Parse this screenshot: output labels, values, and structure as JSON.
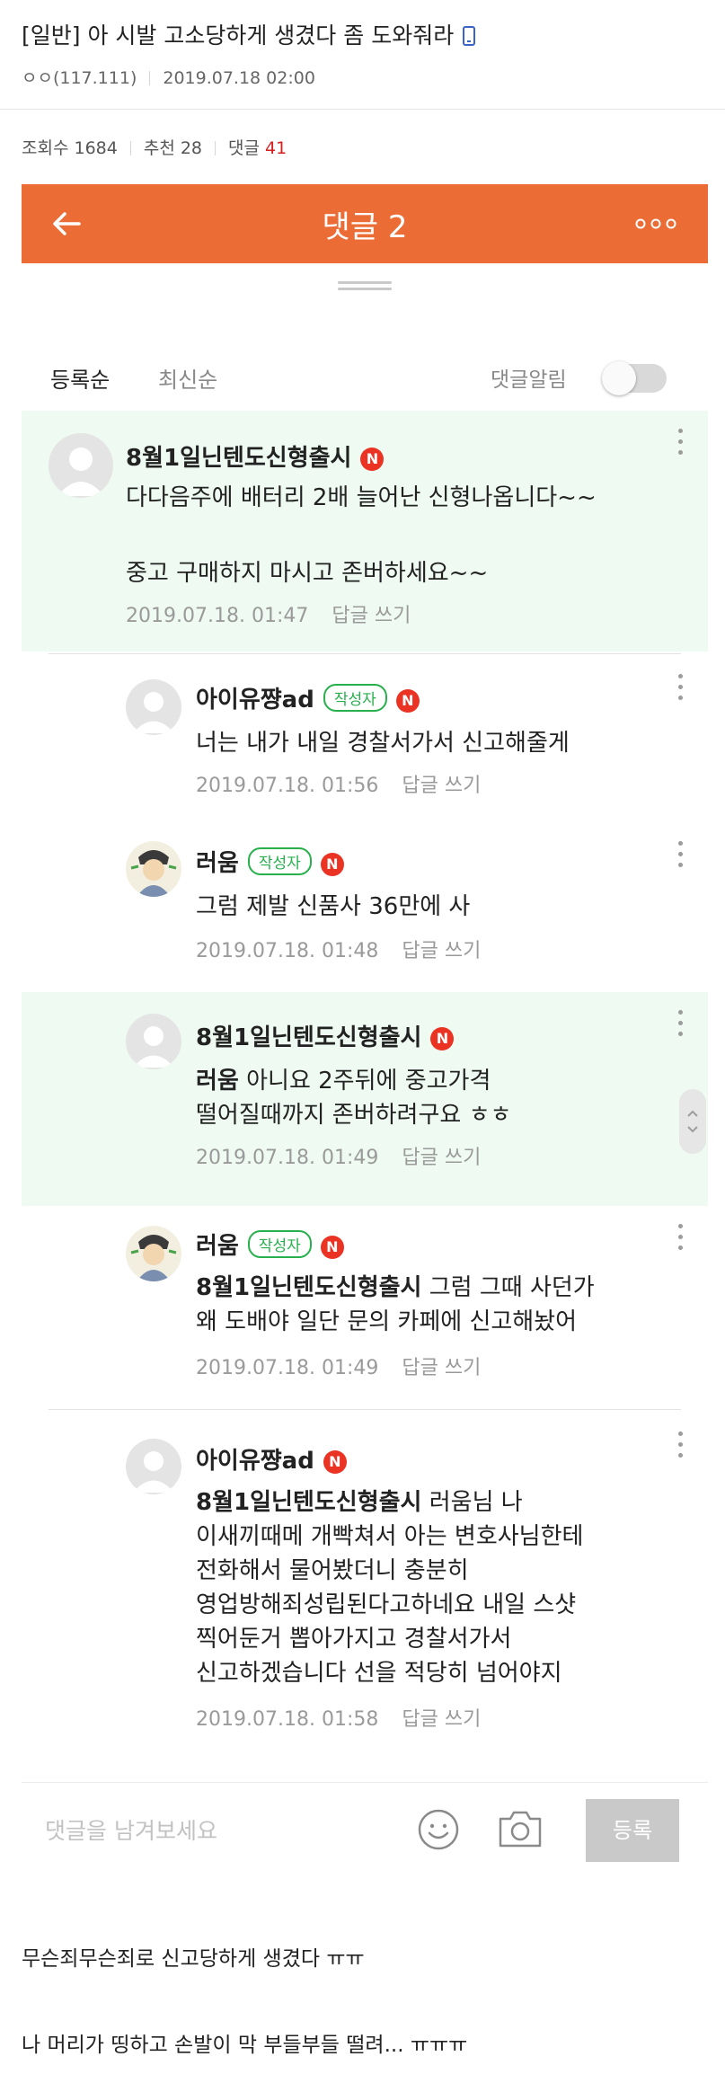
{
  "post": {
    "title": "[일반] 아 시발 고소당하게 생겼다 좀 도와줘라",
    "author": "ㅇㅇ(117.111)",
    "datetime": "2019.07.18 02:00",
    "views_label": "조회수 1684",
    "recommend_label": "추천 28",
    "comments_label": "댓글",
    "comments_count": "41"
  },
  "app": {
    "title": "댓글 2",
    "sort_registered": "등록순",
    "sort_latest": "최신순",
    "alarm_label": "댓글알림",
    "alarm_on": false,
    "input_placeholder": "댓글을 남겨보세요",
    "submit_label": "등록",
    "reply_label": "답글 쓰기",
    "author_badge": "작성자",
    "naver_badge": "N",
    "accent_color": "#ec6c35",
    "highlight_color": "#eefaf2"
  },
  "comments": [
    {
      "nick": "8월1일닌텐도신형출시",
      "lines": [
        "다다음주에 배터리 2배 늘어난 신형나옵니다~~",
        "",
        "중고 구매하지 마시고 존버하세요~~"
      ],
      "date": "2019.07.18. 01:47"
    },
    {
      "nick": "아이유쨩ad",
      "lines": [
        "너는 내가 내일 경찰서가서 신고해줄게"
      ],
      "date": "2019.07.18. 01:56"
    },
    {
      "nick": "러움",
      "lines": [
        "그럼 제발 신품사 36만에 사"
      ],
      "date": "2019.07.18. 01:48"
    },
    {
      "nick": "8월1일닌텐도신형출시",
      "mention": "러움",
      "lines": [
        " 아니요 2주뒤에 중고가격",
        "떨어질때까지 존버하려구요 ㅎㅎ"
      ],
      "date": "2019.07.18. 01:49"
    },
    {
      "nick": "러움",
      "mention": "8월1일닌텐도신형출시",
      "lines": [
        " 그럼 그때 사던가",
        "왜 도배야 일단 문의 카페에 신고해놨어"
      ],
      "date": "2019.07.18. 01:49"
    },
    {
      "nick": "아이유쨩ad",
      "mention": "8월1일닌텐도신형출시",
      "lines": [
        " 러움님 나",
        "이새끼때메 개빡쳐서 아는 변호사님한테",
        "전화해서 물어봤더니 충분히",
        "영업방해죄성립된다고하네요 내일 스샷",
        "찍어둔거 뽑아가지고 경찰서가서",
        "신고하겠습니다 선을 적당히 넘어야지"
      ],
      "date": "2019.07.18. 01:58"
    }
  ],
  "post_body": [
    "무슨죄무슨죄로 신고당하게 생겼다 ㅠㅠ",
    "나 머리가 띵하고 손발이 막 부들부들 떨려... ㅠㅠㅠ"
  ]
}
